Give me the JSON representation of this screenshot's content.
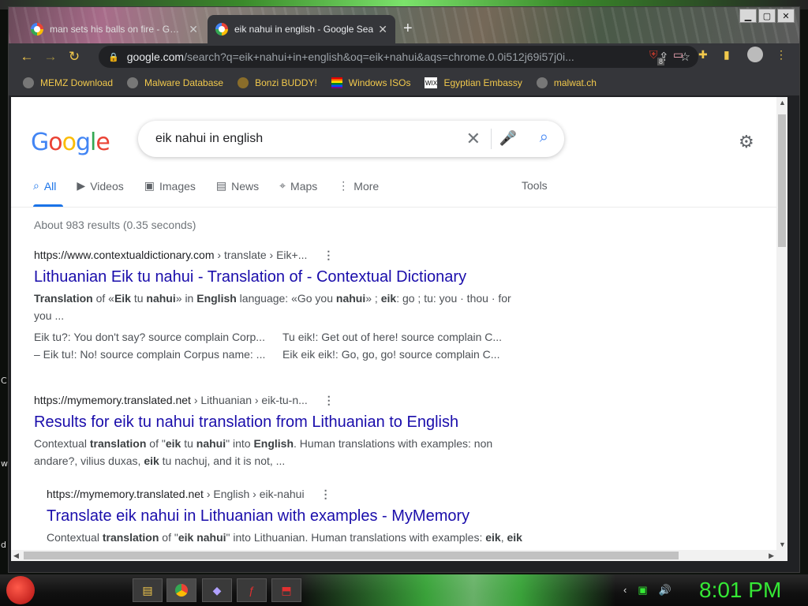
{
  "browser": {
    "tabs": [
      {
        "title": "man sets his balls on fire - Goog",
        "active": false
      },
      {
        "title": "eik nahui in english - Google Sea",
        "active": true
      }
    ],
    "new_tab": "+",
    "url": {
      "host": "google.com",
      "rest": "/search?q=eik+nahui+in+english&oq=eik+nahui&aqs=chrome.0.0i512j69i57j0i..."
    },
    "extension_badge": "8",
    "bookmarks": [
      "MEMZ Download",
      "Malware Database",
      "Bonzi BUDDY!",
      "Windows ISOs",
      "Egyptian Embassy",
      "malwat.ch"
    ]
  },
  "search": {
    "logo": "Google",
    "query": "eik nahui in english",
    "filters": [
      "All",
      "Videos",
      "Images",
      "News",
      "Maps",
      "More"
    ],
    "tools": "Tools",
    "stats": "About 983 results (0.35 seconds)"
  },
  "results": [
    {
      "site": "https://www.contextualdictionary.com",
      "crumbs": " › translate › Eik+...",
      "title": "Lithuanian Eik tu nahui - Translation of - Contextual Dictionary",
      "snippet_html": "<b>Translation</b> of «<b>Eik</b> tu <b>nahui</b>» in <b>English</b> language: «Go you <b>nahui</b>» ; <b>eik</b>: go ; tu: you · thou · for you ...",
      "sub": [
        "Eik tu?: You don't say? source complain Corp...",
        "Tu eik!: Get out of here! source complain C...",
        "– Eik tu!: No! source complain Corpus name: ...",
        "Eik eik eik!: Go, go, go! source complain C..."
      ]
    },
    {
      "site": "https://mymemory.translated.net",
      "crumbs": " › Lithuanian › eik-tu-n...",
      "title": "Results for eik tu nahui translation from Lithuanian to English",
      "snippet_html": "Contextual <b>translation</b> of \"<b>eik</b> tu <b>nahui</b>\" into <b>English</b>. Human translations with examples: non andare?, vilius duxas, <b>eik</b> tu nachuj, and it is not, ..."
    },
    {
      "site": "https://mymemory.translated.net",
      "crumbs": " › English › eik-nahui",
      "title": "Translate eik nahui in Lithuanian with examples - MyMemory",
      "snippet_html": "Contextual <b>translation</b> of \"<b>eik nahui</b>\" into Lithuanian. Human translations with examples: <b>eik</b>, <b>eik</b> nx, <b>eik nahui</b>, pisk <b>nahui</b>, <b>eik</b> tu nachuj, ..."
    }
  ],
  "desktop": {
    "edge_letters": [
      "C",
      "w",
      "d"
    ]
  },
  "taskbar": {
    "clock": "8:01 PM"
  }
}
